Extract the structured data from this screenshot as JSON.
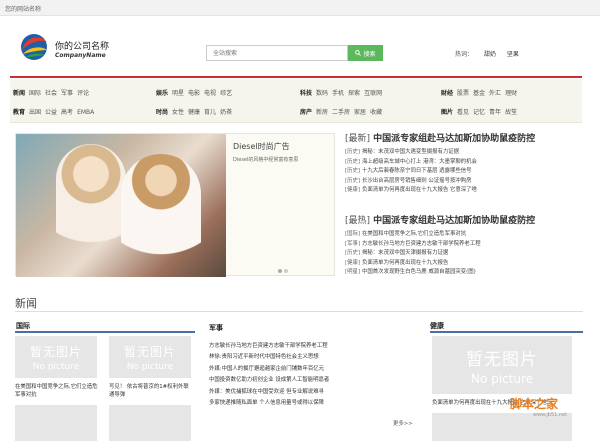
{
  "topbar": {
    "text": "您的网站名称"
  },
  "header": {
    "brand_cn": "你的公司名称",
    "brand_en": "CompanyName",
    "search_placeholder": "全站搜索",
    "search_button": "搜索",
    "hot_label": "热词：",
    "hot_links": [
      "甜奶",
      "坚果"
    ]
  },
  "nav": {
    "groups": [
      {
        "title": "新闻",
        "items": [
          "国际",
          "社会",
          "军事",
          "评论"
        ]
      },
      {
        "title": "娱乐",
        "items": [
          "明星",
          "电影",
          "电视",
          "综艺"
        ]
      },
      {
        "title": "科技",
        "items": [
          "数码",
          "手机",
          "探索",
          "互联网"
        ]
      },
      {
        "title": "财经",
        "items": [
          "股票",
          "基金",
          "外汇",
          "理财"
        ]
      },
      {
        "title": "教育",
        "items": [
          "出国",
          "公益",
          "高考",
          "EMBA"
        ]
      },
      {
        "title": "时尚",
        "items": [
          "女性",
          "健康",
          "育儿",
          "奶茶"
        ]
      },
      {
        "title": "房产",
        "items": [
          "新房",
          "二手房",
          "家居",
          "收藏"
        ]
      },
      {
        "title": "图片",
        "items": [
          "看见",
          "记忆",
          "青年",
          "故笙"
        ]
      }
    ]
  },
  "slider": {
    "title": "Diesel时尚广告",
    "desc": "Diesel的风格中经常富有意思"
  },
  "news": [
    {
      "tag": "[最新]",
      "headline": "中国派专家组赴马达加斯加协助鼠疫防控",
      "items": [
        {
          "cat": "[历史]",
          "text": "揭秘：末茂双中国大遇变型摄报有力证据"
        },
        {
          "cat": "[历史]",
          "text": "海上超级高车城中心打上 港湾：大墨掌聊的机会"
        },
        {
          "cat": "[历史]",
          "text": "十九大后裴春陈奈宁同日下基层 透露哪些信号"
        },
        {
          "cat": "[历史]",
          "text": "长沙出台高层房号销售细则 公证摇号按冲购房"
        },
        {
          "cat": "[健康]",
          "text": "负面清单为何再度出现在十九大报告 它意深了啥"
        }
      ]
    },
    {
      "tag": "[最热]",
      "headline": "中国派专家组赴马达加斯加协助鼠疫防控",
      "items": [
        {
          "cat": "[国际]",
          "text": "在美国和中国竞争之际,它们立造危军事对抗"
        },
        {
          "cat": "[军事]",
          "text": "方志敏长孙马地方巨资建方志敏干部学院养老工程"
        },
        {
          "cat": "[历史]",
          "text": "揭秘：末茂双中国天津摄报有力证据"
        },
        {
          "cat": "[健康]",
          "text": "负面清单为何再度出现在十九大报告"
        },
        {
          "cat": "[明星]",
          "text": "中国首次发现野生白色马鹿 威源自墓园突变(图)"
        }
      ]
    }
  ],
  "section": {
    "title": "新闻"
  },
  "columns": {
    "intl": {
      "title": "国际",
      "captions": [
        "在美国和中国竞争之际,它们立造危军事对抗",
        "写见！ 依古将普京的1#权利外联通导弹"
      ]
    },
    "military": {
      "title": "军事",
      "items": [
        "方志敏长孙马地方巨资建方志敏干部学院养老工程",
        "林徐:贵阳习近平新时代中国特色社会主义思想",
        "外媒:中国人的餐厅邂逅越家企前门铺数年百亿元",
        "中国投资数亿助力初创企业 设成第人工智能明嘉者",
        "外媒：美优捕狐球在中国受欢迎 但专业解说难寻",
        "多家快递推随私面单 个人信息用量号或得以保障"
      ],
      "more": "更多>>"
    },
    "health": {
      "title": "健康",
      "caption": "负面清单为何再度出现在十九大报告 它意深了啥"
    }
  },
  "placeholder": {
    "cn": "暂无图片",
    "en": "No picture"
  },
  "watermark": {
    "main": "脚本之家",
    "sub": "www.jb51.net"
  }
}
